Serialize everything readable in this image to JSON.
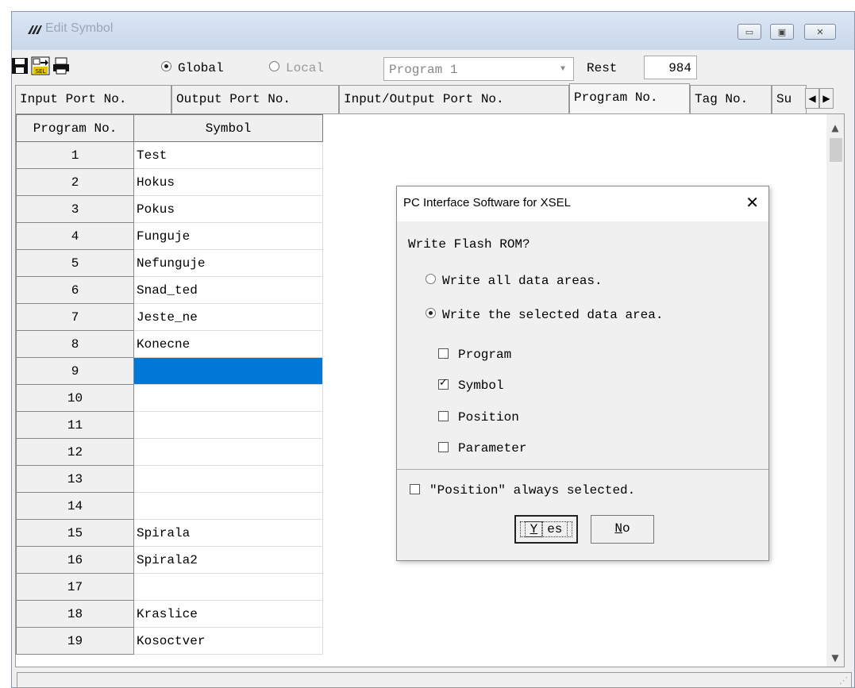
{
  "window": {
    "title": "Edit Symbol"
  },
  "toolbar": {
    "scope_global": "Global",
    "scope_local": "Local",
    "program_select": "Program 1",
    "rest_label": "Rest",
    "rest_value": "984"
  },
  "tabs": [
    {
      "label": "Input Port No."
    },
    {
      "label": "Output Port No."
    },
    {
      "label": "Input/Output Port No."
    },
    {
      "label": "Program No."
    },
    {
      "label": "Tag No."
    },
    {
      "label": "Su"
    }
  ],
  "grid": {
    "headers": [
      "Program No.",
      "Symbol"
    ],
    "rows": [
      {
        "no": "1",
        "symbol": "Test"
      },
      {
        "no": "2",
        "symbol": "Hokus"
      },
      {
        "no": "3",
        "symbol": "Pokus"
      },
      {
        "no": "4",
        "symbol": "Funguje"
      },
      {
        "no": "5",
        "symbol": "Nefunguje"
      },
      {
        "no": "6",
        "symbol": "Snad_ted"
      },
      {
        "no": "7",
        "symbol": "Jeste_ne"
      },
      {
        "no": "8",
        "symbol": "Konecne"
      },
      {
        "no": "9",
        "symbol": ""
      },
      {
        "no": "10",
        "symbol": ""
      },
      {
        "no": "11",
        "symbol": ""
      },
      {
        "no": "12",
        "symbol": ""
      },
      {
        "no": "13",
        "symbol": ""
      },
      {
        "no": "14",
        "symbol": ""
      },
      {
        "no": "15",
        "symbol": "Spirala"
      },
      {
        "no": "16",
        "symbol": "Spirala2"
      },
      {
        "no": "17",
        "symbol": ""
      },
      {
        "no": "18",
        "symbol": "Kraslice"
      },
      {
        "no": "19",
        "symbol": "Kosoctver"
      }
    ]
  },
  "dialog": {
    "title": "PC Interface Software for XSEL",
    "question": "Write Flash ROM?",
    "opt_all": "Write all data areas.",
    "opt_selected": "Write the selected data area.",
    "chk_program": "Program",
    "chk_symbol": "Symbol",
    "chk_position": "Position",
    "chk_parameter": "Parameter",
    "chk_always": "\"Position\" always selected.",
    "yes_first": "Y",
    "yes_rest": "es",
    "no_first": "N",
    "no_rest": "o"
  },
  "colors": {
    "selection": "#0078d7"
  }
}
